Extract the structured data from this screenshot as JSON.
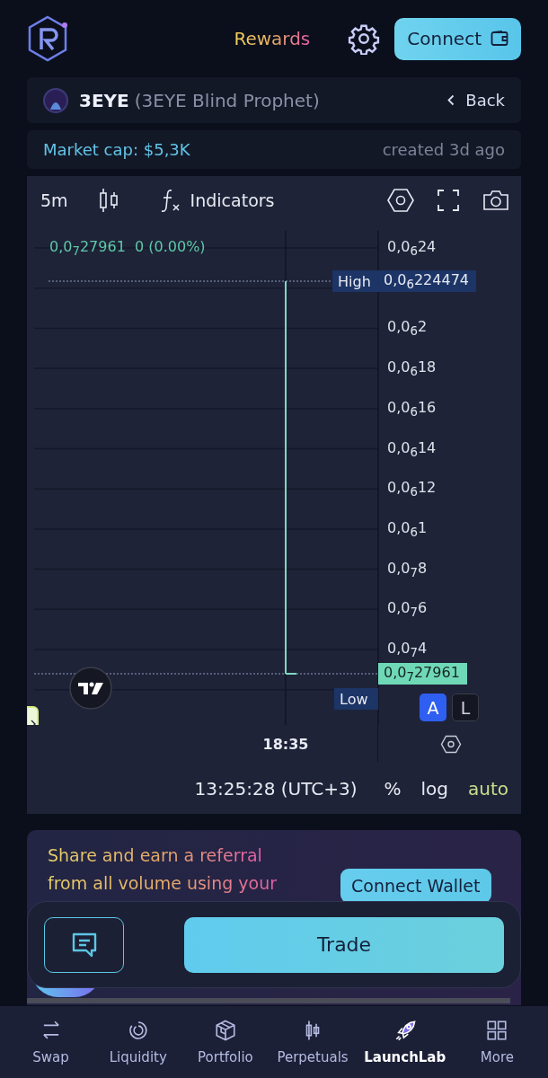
{
  "header": {
    "rewards": "Rewards",
    "connect_button": "Connect"
  },
  "token": {
    "symbol": "3EYE",
    "name": "(3EYE Blind Prophet)",
    "back": "Back"
  },
  "stats": {
    "market_cap": "Market cap: $5,3K",
    "created": "created 3d ago"
  },
  "chart": {
    "interval": "5m",
    "indicators": "Indicators",
    "legend_price": "0,0$_{7}$27961",
    "legend_change": "0 (0.00%)",
    "price_labels": [
      "0,0$_{6}$24",
      "0,0$_{6}$2",
      "0,0$_{6}$18",
      "0,0$_{6}$16",
      "0,0$_{6}$14",
      "0,0$_{6}$12",
      "0,0$_{6}$1",
      "0,0$_{7}$8",
      "0,0$_{7}$6",
      "0,0$_{7}$4"
    ],
    "high_label": "High",
    "high_value": "0,0$_{6}$224474",
    "last_price": "0,0$_{7}$27961",
    "low_label": "Low",
    "scale_buttons": [
      {
        "label": "A",
        "selected": true
      },
      {
        "label": "L",
        "selected": false
      }
    ],
    "time_label": "18:35",
    "clock": "13:25:28 (UTC+3)",
    "footer_options": [
      {
        "label": "%",
        "selected": false
      },
      {
        "label": "log",
        "selected": false
      },
      {
        "label": "auto",
        "selected": true
      }
    ]
  },
  "referral": {
    "lines": [
      "Share and earn a referral",
      "from all volume using your"
    ],
    "button": "Connect Wallet"
  },
  "trade_button": "Trade",
  "nav": [
    {
      "label": "Swap",
      "selected": false
    },
    {
      "label": "Liquidity",
      "selected": false
    },
    {
      "label": "Portfolio",
      "selected": false
    },
    {
      "label": "Perpetuals",
      "selected": false
    },
    {
      "label": "LaunchLab",
      "selected": true
    },
    {
      "label": "More",
      "selected": false
    }
  ]
}
